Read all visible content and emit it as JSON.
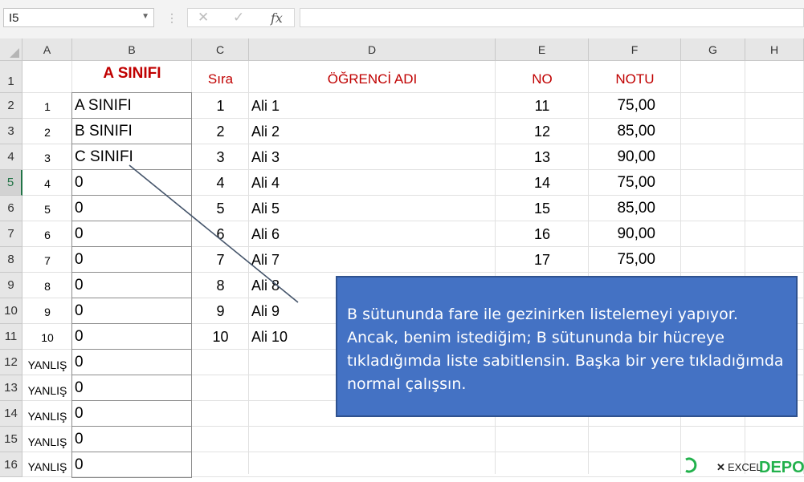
{
  "formula_bar": {
    "name_box": "I5",
    "cancel_icon": "✕",
    "enter_icon": "✓",
    "fx_label": "fx",
    "formula": ""
  },
  "columns": [
    "A",
    "B",
    "C",
    "D",
    "E",
    "F",
    "G",
    "H"
  ],
  "rows": [
    "1",
    "2",
    "3",
    "4",
    "5",
    "6",
    "7",
    "8",
    "9",
    "10",
    "11",
    "12",
    "13",
    "14",
    "15",
    "16"
  ],
  "selected_row": "5",
  "headers": {
    "b1": "A SINIFI",
    "c1": "Sıra",
    "d1": "ÖĞRENCİ ADI",
    "e1": "NO",
    "f1": "NOTU"
  },
  "col_a": [
    "1",
    "2",
    "3",
    "4",
    "5",
    "6",
    "7",
    "8",
    "9",
    "10",
    "YANLIŞ",
    "YANLIŞ",
    "YANLIŞ",
    "YANLIŞ",
    "YANLIŞ"
  ],
  "col_b": [
    "A SINIFI",
    "B SINIFI",
    "C SINIFI",
    "0",
    "0",
    "0",
    "0",
    "0",
    "0",
    "0",
    "0",
    "0",
    "0",
    "0",
    "0"
  ],
  "col_c": [
    "1",
    "2",
    "3",
    "4",
    "5",
    "6",
    "7",
    "8",
    "9",
    "10"
  ],
  "col_d": [
    "Ali 1",
    "Ali 2",
    "Ali 3",
    "Ali 4",
    "Ali 5",
    "Ali 6",
    "Ali 7",
    "Ali 8",
    "Ali 9",
    "Ali 10"
  ],
  "col_e": [
    "11",
    "12",
    "13",
    "14",
    "15",
    "16",
    "17"
  ],
  "col_f": [
    "75,00",
    "85,00",
    "90,00",
    "75,00",
    "85,00",
    "90,00",
    "75,00"
  ],
  "callout": {
    "lines": [
      "B sütununda fare ile gezinirken listelemeyi yapıyor.",
      "Ancak, benim istediğim; B  sütununda bir hücreye",
      "tıkladığımda liste sabitlensin. Başka bir yere tıkladığımda",
      "normal çalışsın."
    ],
    "fill": "#4472c4"
  },
  "colors": {
    "header_red": "#c00000",
    "selected_row_green": "#217346",
    "connector": "#44546a"
  },
  "watermark": "EXCEL DEPO"
}
